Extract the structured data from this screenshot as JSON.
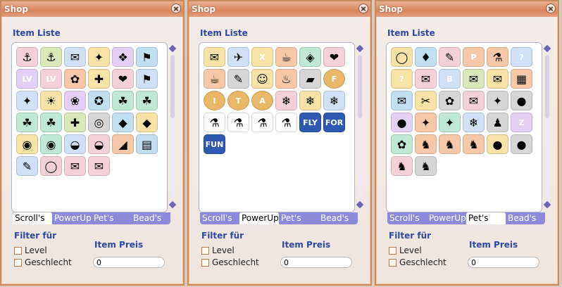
{
  "windows": [
    {
      "title": "Shop",
      "list_label": "Item Liste",
      "tabs": [
        "Scroll's",
        "PowerUp's",
        "Pet's",
        "Bead's"
      ],
      "active_tab": 0,
      "filter_label": "Filter für",
      "price_label": "Item Preis",
      "level_label": "Level",
      "gender_label": "Geschlecht",
      "price_value": "0",
      "items": [
        {
          "icon": "⚓",
          "cls": "c1"
        },
        {
          "icon": "⚓",
          "cls": "c2"
        },
        {
          "icon": "✉",
          "cls": "c3"
        },
        {
          "icon": "✦",
          "cls": "c4"
        },
        {
          "icon": "❖",
          "cls": "c5"
        },
        {
          "icon": "⚑",
          "cls": "c9"
        },
        {
          "icon": "LV",
          "cls": "c5 txt"
        },
        {
          "icon": "LV",
          "cls": "c1 txt"
        },
        {
          "icon": "✿",
          "cls": "c7"
        },
        {
          "icon": "✚",
          "cls": "c4"
        },
        {
          "icon": "❤",
          "cls": "c1"
        },
        {
          "icon": "⚑",
          "cls": "c3"
        },
        {
          "icon": "✦",
          "cls": "c3"
        },
        {
          "icon": "☀",
          "cls": "c4"
        },
        {
          "icon": "❀",
          "cls": "c5"
        },
        {
          "icon": "✪",
          "cls": "c9"
        },
        {
          "icon": "☘",
          "cls": "c6"
        },
        {
          "icon": "☘",
          "cls": "c6"
        },
        {
          "icon": "☘",
          "cls": "c6"
        },
        {
          "icon": "☘",
          "cls": "c6"
        },
        {
          "icon": "✚",
          "cls": "c2"
        },
        {
          "icon": "◎",
          "cls": "c8"
        },
        {
          "icon": "◆",
          "cls": "c9"
        },
        {
          "icon": "◆",
          "cls": "c4"
        },
        {
          "icon": "◉",
          "cls": "c4"
        },
        {
          "icon": "◉",
          "cls": "c6"
        },
        {
          "icon": "◒",
          "cls": "c3"
        },
        {
          "icon": "◒",
          "cls": "c1"
        },
        {
          "icon": "◢",
          "cls": "c7"
        },
        {
          "icon": "▤",
          "cls": "c9"
        },
        {
          "icon": "✎",
          "cls": "c3"
        },
        {
          "icon": "◯",
          "cls": "c1"
        },
        {
          "icon": "✉",
          "cls": "c1"
        },
        {
          "icon": "✉",
          "cls": "c1"
        }
      ]
    },
    {
      "title": "Shop",
      "list_label": "Item Liste",
      "tabs": [
        "Scroll's",
        "PowerUp's",
        "Pet's",
        "Bead's"
      ],
      "active_tab": 1,
      "filter_label": "Filter für",
      "price_label": "Item Preis",
      "level_label": "Level",
      "gender_label": "Geschlecht",
      "price_value": "0",
      "items": [
        {
          "icon": "✉",
          "cls": "c4"
        },
        {
          "icon": "✈",
          "cls": "c3"
        },
        {
          "icon": "X",
          "cls": "c4 txt"
        },
        {
          "icon": "☕",
          "cls": "c7"
        },
        {
          "icon": "◈",
          "cls": "c6"
        },
        {
          "icon": "❤",
          "cls": "c1"
        },
        {
          "icon": "☕",
          "cls": "c7"
        },
        {
          "icon": "✎",
          "cls": "c8"
        },
        {
          "icon": "☺",
          "cls": "c4"
        },
        {
          "icon": "♨",
          "cls": "c7"
        },
        {
          "icon": "▰",
          "cls": "c8"
        },
        {
          "icon": "F",
          "cls": "coin txt"
        },
        {
          "icon": "I",
          "cls": "coin txt"
        },
        {
          "icon": "T",
          "cls": "coin txt"
        },
        {
          "icon": "A",
          "cls": "coin txt"
        },
        {
          "icon": "❄",
          "cls": "c1"
        },
        {
          "icon": "❄",
          "cls": "c4"
        },
        {
          "icon": "❄",
          "cls": "c3"
        },
        {
          "icon": "⚗",
          "cls": "pot"
        },
        {
          "icon": "⚗",
          "cls": "pot"
        },
        {
          "icon": "⚗",
          "cls": "pot"
        },
        {
          "icon": "⚗",
          "cls": "pot"
        },
        {
          "icon": "FLY",
          "cls": "blue txt"
        },
        {
          "icon": "FOR",
          "cls": "blue txt"
        },
        {
          "icon": "FUN",
          "cls": "blue txt"
        }
      ]
    },
    {
      "title": "Shop",
      "list_label": "Item Liste",
      "tabs": [
        "Scroll's",
        "PowerUp's",
        "Pet's",
        "Bead's"
      ],
      "active_tab": 2,
      "filter_label": "Filter für",
      "price_label": "Item Preis",
      "level_label": "Level",
      "gender_label": "Geschlecht",
      "price_value": "0",
      "items": [
        {
          "icon": "◯",
          "cls": "c4"
        },
        {
          "icon": "♦",
          "cls": "c9"
        },
        {
          "icon": "✎",
          "cls": "c1"
        },
        {
          "icon": "P",
          "cls": "c7 txt"
        },
        {
          "icon": "⚗",
          "cls": "c7"
        },
        {
          "icon": "?",
          "cls": "c3 txt"
        },
        {
          "icon": "?",
          "cls": "c4 txt"
        },
        {
          "icon": "✉",
          "cls": "c1"
        },
        {
          "icon": "B",
          "cls": "c3 txt"
        },
        {
          "icon": "✉",
          "cls": "c2"
        },
        {
          "icon": "✉",
          "cls": "c4"
        },
        {
          "icon": "▦",
          "cls": "c7"
        },
        {
          "icon": "✉",
          "cls": "c9"
        },
        {
          "icon": "✂",
          "cls": "c4"
        },
        {
          "icon": "✿",
          "cls": "c8"
        },
        {
          "icon": "✉",
          "cls": "c1"
        },
        {
          "icon": "✦",
          "cls": "c8"
        },
        {
          "icon": "●",
          "cls": "c8"
        },
        {
          "icon": "●",
          "cls": "c5"
        },
        {
          "icon": "✦",
          "cls": "c7"
        },
        {
          "icon": "✦",
          "cls": "c6"
        },
        {
          "icon": "❄",
          "cls": "c3"
        },
        {
          "icon": "♟",
          "cls": "c8"
        },
        {
          "icon": "Z",
          "cls": "c5 txt"
        },
        {
          "icon": "✿",
          "cls": "c6"
        },
        {
          "icon": "♞",
          "cls": "c7"
        },
        {
          "icon": "♞",
          "cls": "c7"
        },
        {
          "icon": "♞",
          "cls": "c7"
        },
        {
          "icon": "●",
          "cls": "c4"
        },
        {
          "icon": "●",
          "cls": "c8"
        },
        {
          "icon": "♞",
          "cls": "c1"
        },
        {
          "icon": "♞",
          "cls": "c8"
        }
      ]
    }
  ]
}
